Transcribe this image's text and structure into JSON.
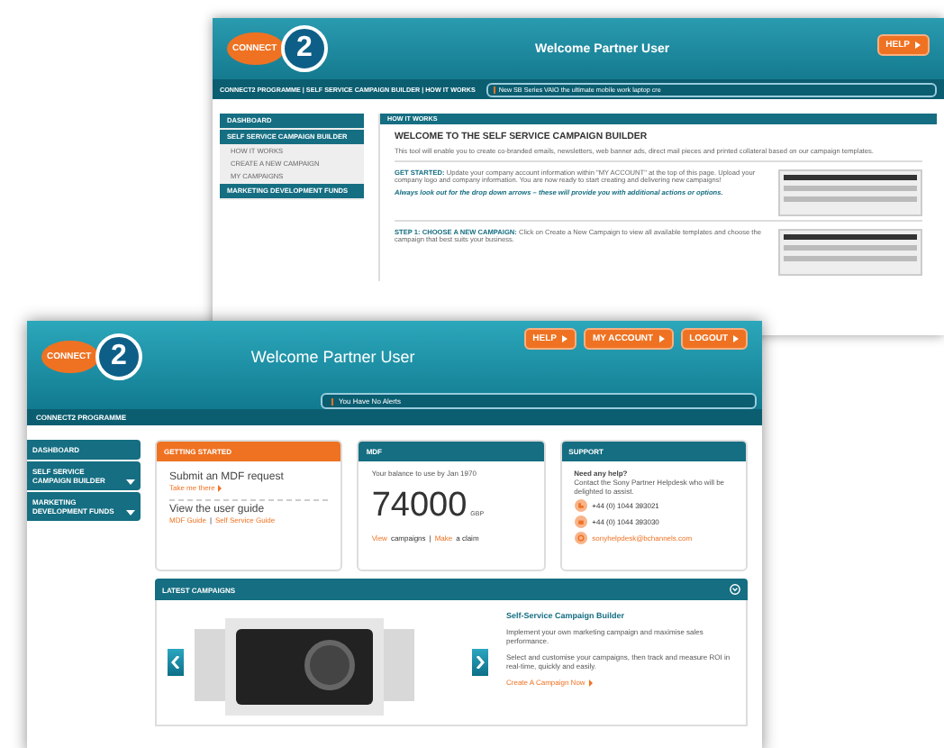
{
  "back_window": {
    "logo": {
      "word": "CONNECT",
      "number": "2"
    },
    "title": "Welcome Partner User",
    "header_buttons": [
      "HELP"
    ],
    "nav": "CONNECT2 PROGRAMME | SELF SERVICE CAMPAIGN BUILDER | HOW IT WORKS",
    "alert": "New SB Series VAIO the ultimate mobile work laptop cre",
    "sidebar": [
      {
        "label": "DASHBOARD",
        "kind": "section"
      },
      {
        "label": "SELF SERVICE CAMPAIGN BUILDER",
        "kind": "section"
      },
      {
        "label": "HOW IT WORKS",
        "kind": "sub"
      },
      {
        "label": "CREATE A NEW CAMPAIGN",
        "kind": "sub"
      },
      {
        "label": "MY CAMPAIGNS",
        "kind": "sub"
      },
      {
        "label": "MARKETING DEVELOPMENT FUNDS",
        "kind": "section"
      }
    ],
    "section_title": "HOW IT WORKS",
    "heading": "WELCOME TO THE SELF SERVICE CAMPAIGN BUILDER",
    "intro": "This tool will enable you to create co-branded emails, newsletters, web banner ads, direct mail pieces and printed collateral based on our campaign templates.",
    "steps": [
      {
        "text": "**GET STARTED:** Update your company account information within \"MY ACCOUNT\" at the top of this page. Upload your company logo and company information. You are now ready to start creating and delivering new campaigns!",
        "note": "Always look out for the drop down arrows – these will provide you with additional actions or options."
      },
      {
        "text": "**STEP 1: CHOOSE A NEW CAMPAIGN:** Click on Create a New Campaign to view all available templates and choose the campaign that best suits your business."
      }
    ]
  },
  "front_window": {
    "logo": {
      "word": "CONNECT",
      "number": "2"
    },
    "title": "Welcome Partner User",
    "header_buttons": [
      "HELP",
      "MY ACCOUNT",
      "LOGOUT"
    ],
    "alert": "You Have No Alerts",
    "nav": "CONNECT2 PROGRAMME",
    "sidebar": [
      {
        "label": "DASHBOARD",
        "has_menu": false
      },
      {
        "label": "SELF SERVICE CAMPAIGN BUILDER",
        "has_menu": true
      },
      {
        "label": "MARKETING DEVELOPMENT FUNDS",
        "has_menu": true
      }
    ],
    "getting_started": {
      "title": "GETTING STARTED",
      "items": [
        {
          "title": "Submit an MDF request",
          "parts": [
            {
              "text": "Take me there",
              "kind": "link"
            }
          ],
          "arrow": true
        },
        {
          "title": "View the user guide",
          "parts": [
            {
              "text": "MDF Guide",
              "kind": "link"
            },
            {
              "text": "|",
              "kind": "text"
            },
            {
              "text": "Self Service Guide",
              "kind": "link"
            }
          ],
          "arrow": false
        }
      ]
    },
    "mdf": {
      "title": "MDF",
      "caption": "Your balance to use by Jan 1970",
      "amount": "74000",
      "currency": "GBP",
      "parts": [
        {
          "text": "View",
          "kind": "link"
        },
        {
          "text": "campaigns",
          "kind": "text"
        },
        {
          "text": "|",
          "kind": "text"
        },
        {
          "text": "Make",
          "kind": "link"
        },
        {
          "text": "a claim",
          "kind": "text"
        }
      ]
    },
    "support": {
      "title": "SUPPORT",
      "heading": "Need any help?",
      "text": "Contact the Sony Partner Helpdesk who will be delighted to assist.",
      "contacts": [
        {
          "kind": "phone",
          "text": "+44 (0) 1044 393021"
        },
        {
          "kind": "fax",
          "text": "+44 (0) 1044 393030"
        },
        {
          "kind": "email",
          "text": "sonyhelpdesk@bchannels.com"
        }
      ]
    },
    "latest_campaigns": {
      "title": "LATEST CAMPAIGNS",
      "heading": "Self-Service Campaign Builder",
      "paragraphs": [
        "Implement your own marketing campaign and maximise sales performance.",
        "Select and customise your campaigns, then track and measure ROI in real-time, quickly and easily."
      ],
      "link": "Create A Campaign Now"
    }
  }
}
